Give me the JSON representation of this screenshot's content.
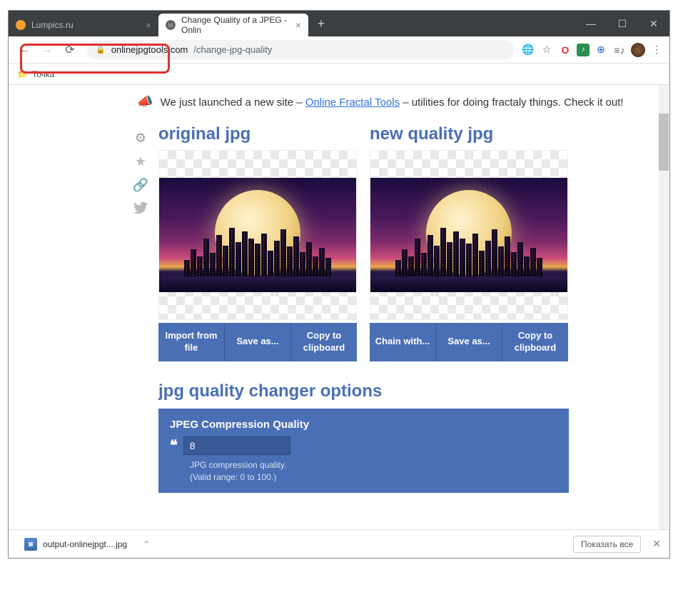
{
  "window": {
    "tab1_title": "Lumpics.ru",
    "tab2_title": "Change Quality of a JPEG - Onlin",
    "minimize": "—",
    "maximize": "☐",
    "close": "✕"
  },
  "address": {
    "url_domain": "onlinejpgtools.com",
    "url_path": "/change-jpg-quality"
  },
  "bookmarks": {
    "item1": "Точка"
  },
  "announce": {
    "text_pre": "We just launched a new site – ",
    "link": "Online Fractal Tools",
    "text_post": " – utilities for doing fractaly things. Check it out!"
  },
  "panels": {
    "left_title": "original jpg",
    "right_title": "new quality jpg",
    "btn_import": "Import from file",
    "btn_save": "Save as...",
    "btn_copy": "Copy to clipboard",
    "btn_chain": "Chain with..."
  },
  "options": {
    "heading": "jpg quality changer options",
    "sub": "JPEG Compression Quality",
    "value": "8",
    "help1": "JPG compression quality.",
    "help2": "(Valid range: 0 to 100.)"
  },
  "download": {
    "filename": "output-onlinejpgt....jpg",
    "show_all": "Показать все"
  }
}
